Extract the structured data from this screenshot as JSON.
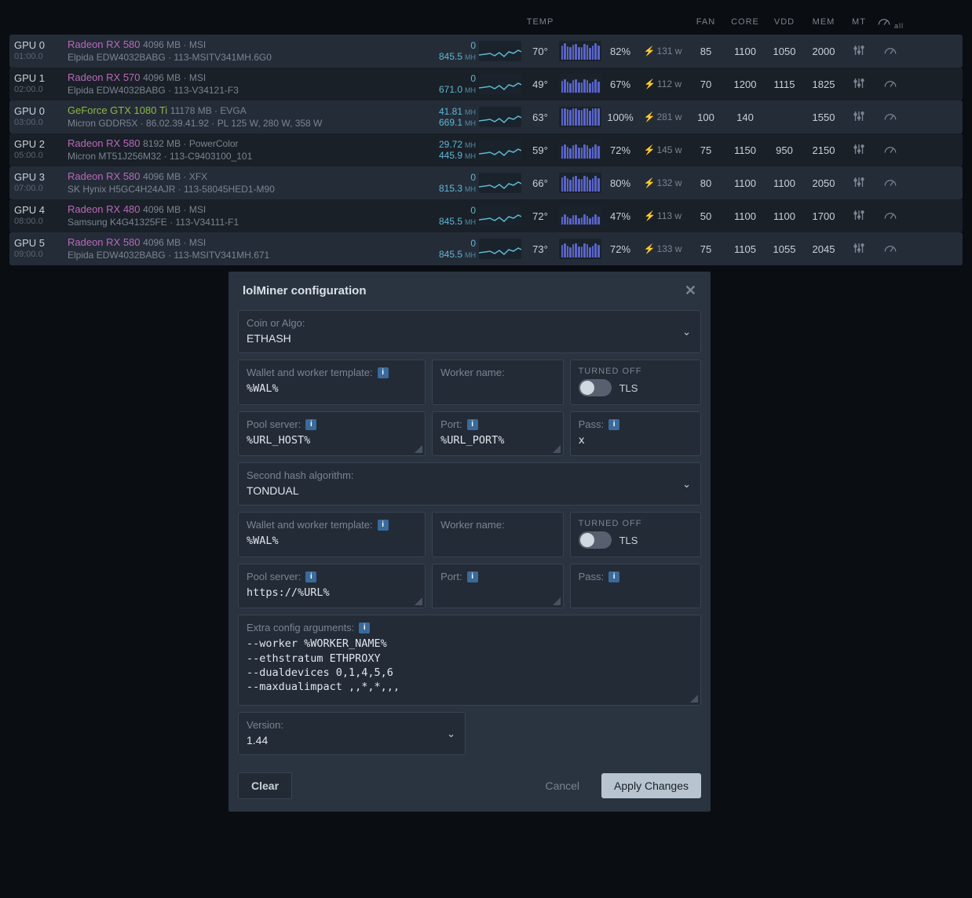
{
  "headers": {
    "temp": "TEMP",
    "fan": "FAN",
    "core": "CORE",
    "vdd": "VDD",
    "mem": "MEM",
    "mt": "MT",
    "all": "all"
  },
  "gpus": [
    {
      "id": "GPU 0",
      "bus": "01:00.0",
      "model": "Radeon RX 580",
      "model_class": "magenta",
      "specs": "4096 MB · MSI",
      "memchip": "Elpida EDW4032BABG · 113-MSITV341MH.6G0",
      "hash1": "0",
      "hash2": "845.5",
      "unit": "MH",
      "temp": "70°",
      "load": "82%",
      "power": "131 w",
      "fan": "85",
      "core": "1100",
      "vdd": "1050",
      "mem": "2000"
    },
    {
      "id": "GPU 1",
      "bus": "02:00.0",
      "model": "Radeon RX 570",
      "model_class": "magenta",
      "specs": "4096 MB · MSI",
      "memchip": "Elpida EDW4032BABG · 113-V34121-F3",
      "hash1": "0",
      "hash2": "671.0",
      "unit": "MH",
      "temp": "49°",
      "load": "67%",
      "power": "112 w",
      "fan": "70",
      "core": "1200",
      "vdd": "1115",
      "mem": "1825"
    },
    {
      "id": "GPU 0",
      "bus": "03:00.0",
      "model": "GeForce GTX 1080 Ti",
      "model_class": "green",
      "specs": "11178 MB · EVGA",
      "memchip": "Micron GDDR5X · 86.02.39.41.92 · PL 125 W, 280 W, 358 W",
      "hash1": "41.81",
      "hash2": "669.1",
      "unit": "MH",
      "temp": "63°",
      "load": "100%",
      "power": "281 w",
      "fan": "100",
      "core": "140",
      "vdd": "",
      "mem": "1550"
    },
    {
      "id": "GPU 2",
      "bus": "05:00.0",
      "model": "Radeon RX 580",
      "model_class": "magenta",
      "specs": "8192 MB · PowerColor",
      "memchip": "Micron MT51J256M32 · 113-C9403100_101",
      "hash1": "29.72",
      "hash2": "445.9",
      "unit": "MH",
      "temp": "59°",
      "load": "72%",
      "power": "145 w",
      "fan": "75",
      "core": "1150",
      "vdd": "950",
      "mem": "2150"
    },
    {
      "id": "GPU 3",
      "bus": "07:00.0",
      "model": "Radeon RX 580",
      "model_class": "magenta",
      "specs": "4096 MB · XFX",
      "memchip": "SK Hynix H5GC4H24AJR · 113-58045HED1-M90",
      "hash1": "0",
      "hash2": "815.3",
      "unit": "MH",
      "temp": "66°",
      "load": "80%",
      "power": "132 w",
      "fan": "80",
      "core": "1100",
      "vdd": "1100",
      "mem": "2050"
    },
    {
      "id": "GPU 4",
      "bus": "08:00.0",
      "model": "Radeon RX 480",
      "model_class": "magenta",
      "specs": "4096 MB · MSI",
      "memchip": "Samsung K4G41325FE · 113-V34111-F1",
      "hash1": "0",
      "hash2": "845.5",
      "unit": "MH",
      "temp": "72°",
      "load": "47%",
      "power": "113 w",
      "fan": "50",
      "core": "1100",
      "vdd": "1100",
      "mem": "1700"
    },
    {
      "id": "GPU 5",
      "bus": "09:00.0",
      "model": "Radeon RX 580",
      "model_class": "magenta",
      "specs": "4096 MB · MSI",
      "memchip": "Elpida EDW4032BABG · 113-MSITV341MH.671",
      "hash1": "0",
      "hash2": "845.5",
      "unit": "MH",
      "temp": "73°",
      "load": "72%",
      "power": "133 w",
      "fan": "75",
      "core": "1105",
      "vdd": "1055",
      "mem": "2045"
    }
  ],
  "modal": {
    "title": "lolMiner configuration",
    "coin_label": "Coin or Algo:",
    "coin_value": "ETHASH",
    "wallet_label": "Wallet and worker template:",
    "wallet_value": "%WAL%",
    "worker_label": "Worker name:",
    "worker_value": "",
    "tls_off": "TURNED OFF",
    "tls_label": "TLS",
    "pool_label": "Pool server:",
    "pool_value": "%URL_HOST%",
    "port_label": "Port:",
    "port_value": "%URL_PORT%",
    "pass_label": "Pass:",
    "pass_value": "x",
    "second_algo_label": "Second hash algorithm:",
    "second_algo_value": "TONDUAL",
    "wallet2_value": "%WAL%",
    "worker2_value": "",
    "pool2_value": "https://%URL%",
    "port2_value": "",
    "pass2_value": "",
    "extra_label": "Extra config arguments:",
    "extra_value": "--worker %WORKER_NAME%\n--ethstratum ETHPROXY\n--dualdevices 0,1,4,5,6\n--maxdualimpact ,,*,*,,,",
    "version_label": "Version:",
    "version_value": "1.44",
    "clear": "Clear",
    "cancel": "Cancel",
    "apply": "Apply Changes"
  }
}
